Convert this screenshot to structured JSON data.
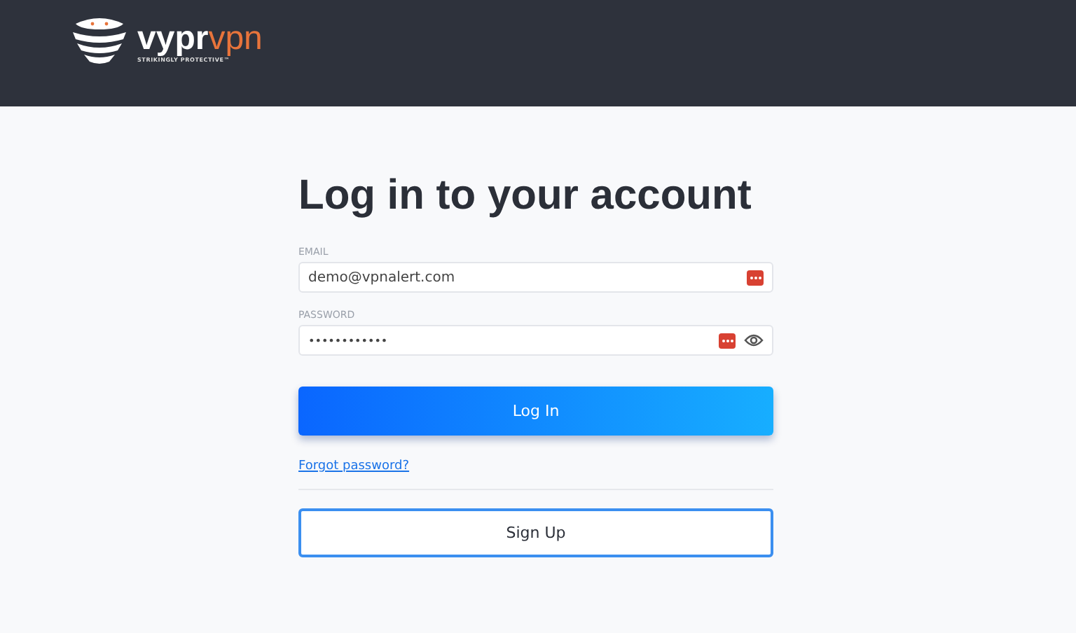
{
  "header": {
    "logo": {
      "brand_primary": "vypr",
      "brand_secondary": "vpn",
      "tagline": "STRIKINGLY PROTECTIVE™"
    }
  },
  "form": {
    "title": "Log in to your account",
    "fields": [
      {
        "label": "EMAIL",
        "value": "demo@vpnalert.com",
        "kind": "text"
      },
      {
        "label": "PASSWORD",
        "value": "••••••••••••",
        "kind": "password"
      }
    ],
    "login_button": "Log In",
    "forgot_link": "Forgot password?",
    "signup_button": "Sign Up"
  }
}
